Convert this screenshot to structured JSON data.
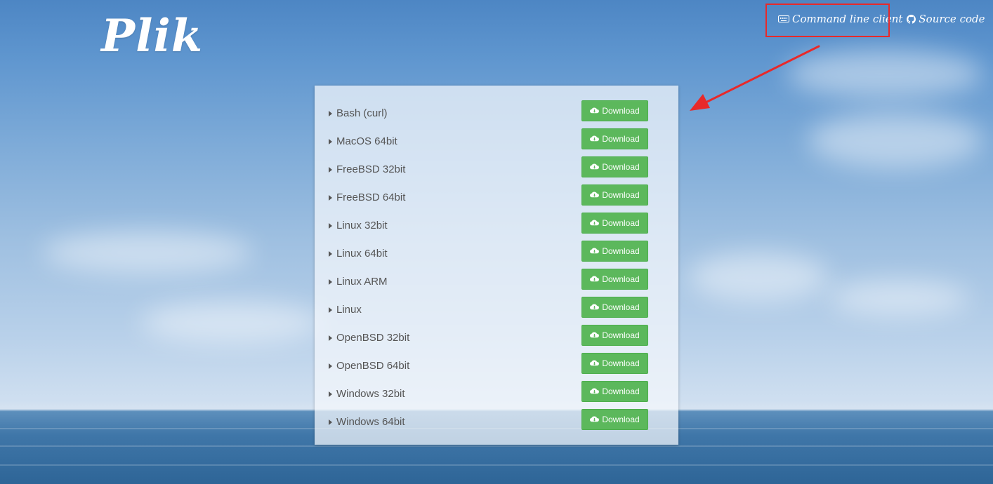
{
  "header": {
    "logo": "Plik",
    "links": [
      {
        "label": "Command line client",
        "icon": "keyboard-icon"
      },
      {
        "label": "Source code",
        "icon": "github-icon"
      }
    ]
  },
  "downloads": {
    "button_label": "Download",
    "button_icon": "cloud-download-icon",
    "items": [
      {
        "label": "Bash (curl)"
      },
      {
        "label": "MacOS 64bit"
      },
      {
        "label": "FreeBSD 32bit"
      },
      {
        "label": "FreeBSD 64bit"
      },
      {
        "label": "Linux 32bit"
      },
      {
        "label": "Linux 64bit"
      },
      {
        "label": "Linux ARM"
      },
      {
        "label": "Linux"
      },
      {
        "label": "OpenBSD 32bit"
      },
      {
        "label": "OpenBSD 64bit"
      },
      {
        "label": "Windows 32bit"
      },
      {
        "label": "Windows 64bit"
      }
    ]
  },
  "colors": {
    "download_button": "#5cb85c",
    "annotation": "#e8292a"
  }
}
